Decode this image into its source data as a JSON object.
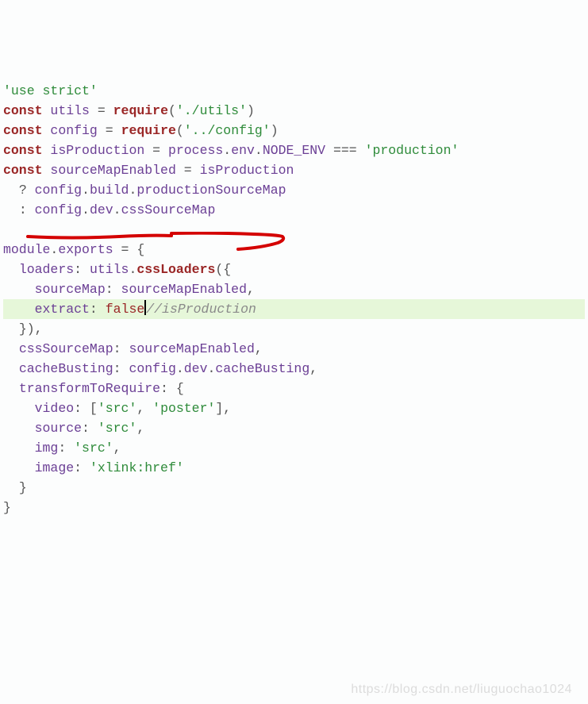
{
  "lines": {
    "l1_str": "'use strict'",
    "l2_kw": "const",
    "l2_id": "utils",
    "l2_req": "require",
    "l2_arg": "'./utils'",
    "l3_kw": "const",
    "l3_id": "config",
    "l3_req": "require",
    "l3_arg": "'../config'",
    "l4_kw": "const",
    "l4_id": "isProduction",
    "l4_p1": "process",
    "l4_p2": "env",
    "l4_p3": "NODE_ENV",
    "l4_str": "'production'",
    "l5_kw": "const",
    "l5_id": "sourceMapEnabled",
    "l5_rhs": "isProduction",
    "l6_a": "config",
    "l6_b": "build",
    "l6_c": "productionSourceMap",
    "l7_a": "config",
    "l7_b": "dev",
    "l7_c": "cssSourceMap",
    "l9_a": "module",
    "l9_b": "exports",
    "l10_k": "loaders",
    "l10_a": "utils",
    "l10_b": "cssLoaders",
    "l11_k": "sourceMap",
    "l11_v": "sourceMapEnabled",
    "l12_k": "extract",
    "l12_v": "false",
    "l12_c": "//isProduction",
    "l14_k": "cssSourceMap",
    "l14_v": "sourceMapEnabled",
    "l15_k": "cacheBusting",
    "l15_a": "config",
    "l15_b": "dev",
    "l15_c": "cacheBusting",
    "l16_k": "transformToRequire",
    "l17_k": "video",
    "l17_a": "'src'",
    "l17_b": "'poster'",
    "l18_k": "source",
    "l18_v": "'src'",
    "l19_k": "img",
    "l19_v": "'src'",
    "l20_k": "image",
    "l20_v": "'xlink:href'"
  },
  "watermark": "https://blog.csdn.net/liuguochao1024"
}
